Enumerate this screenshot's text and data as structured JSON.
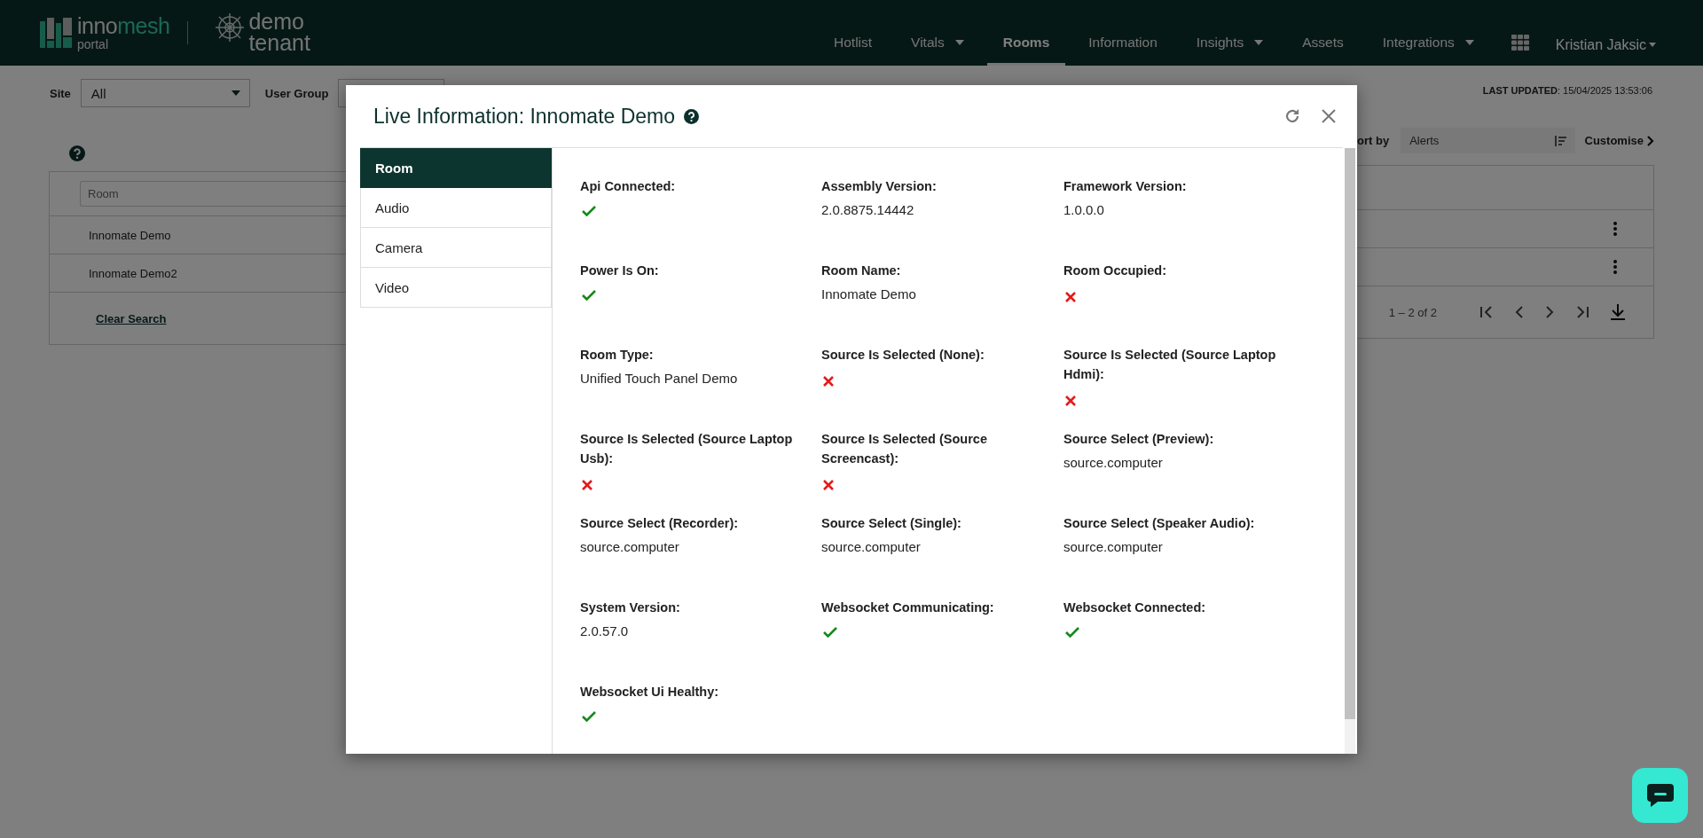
{
  "header": {
    "logo": {
      "brand_a": "inno",
      "brand_b": "mesh",
      "sub": "portal"
    },
    "tenant": {
      "line1": "demo",
      "line2": "tenant"
    },
    "nav": [
      {
        "label": "Hotlist",
        "selected": false,
        "dropdown": false
      },
      {
        "label": "Vitals",
        "selected": false,
        "dropdown": true
      },
      {
        "label": "Rooms",
        "selected": true,
        "dropdown": false
      },
      {
        "label": "Information",
        "selected": false,
        "dropdown": false
      },
      {
        "label": "Insights",
        "selected": false,
        "dropdown": true
      },
      {
        "label": "Assets",
        "selected": false,
        "dropdown": false
      },
      {
        "label": "Integrations",
        "selected": false,
        "dropdown": true
      }
    ],
    "user": "Kristian Jaksic"
  },
  "filters": {
    "site_label": "Site",
    "site_value": "All",
    "user_group_label": "User Group"
  },
  "last_updated": {
    "label": "LAST UPDATED",
    "value": ": 15/04/2025 13:53:06"
  },
  "sort": {
    "label": "ort by",
    "value": "Alerts",
    "customise": "Customise"
  },
  "table": {
    "search_placeholder": "Room",
    "rows": [
      {
        "name": "Innomate Demo"
      },
      {
        "name": "Innomate Demo2"
      }
    ],
    "clear": "Clear Search",
    "range": "1 – 2 of 2"
  },
  "modal": {
    "title": "Live Information: Innomate Demo",
    "tabs": [
      {
        "label": "Room",
        "selected": true
      },
      {
        "label": "Audio",
        "selected": false
      },
      {
        "label": "Camera",
        "selected": false
      },
      {
        "label": "Video",
        "selected": false
      }
    ],
    "fields": [
      {
        "label": "Api Connected:",
        "kind": "status",
        "ok": true
      },
      {
        "label": "Assembly Version:",
        "kind": "text",
        "value": "2.0.8875.14442"
      },
      {
        "label": "Framework Version:",
        "kind": "text",
        "value": "1.0.0.0"
      },
      {
        "label": "Power Is On:",
        "kind": "status",
        "ok": true
      },
      {
        "label": "Room Name:",
        "kind": "text",
        "value": "Innomate Demo"
      },
      {
        "label": "Room Occupied:",
        "kind": "status",
        "ok": false
      },
      {
        "label": "Room Type:",
        "kind": "text",
        "value": "Unified Touch Panel Demo"
      },
      {
        "label": "Source Is Selected (None):",
        "kind": "status",
        "ok": false
      },
      {
        "label": "Source Is Selected (Source Laptop Hdmi):",
        "kind": "status",
        "ok": false
      },
      {
        "label": "Source Is Selected (Source Laptop Usb):",
        "kind": "status",
        "ok": false
      },
      {
        "label": "Source Is Selected (Source Screencast):",
        "kind": "status",
        "ok": false
      },
      {
        "label": "Source Select (Preview):",
        "kind": "text",
        "value": "source.computer"
      },
      {
        "label": "Source Select (Recorder):",
        "kind": "text",
        "value": "source.computer"
      },
      {
        "label": "Source Select (Single):",
        "kind": "text",
        "value": "source.computer"
      },
      {
        "label": "Source Select (Speaker Audio):",
        "kind": "text",
        "value": "source.computer"
      },
      {
        "label": "System Version:",
        "kind": "text",
        "value": "2.0.57.0"
      },
      {
        "label": "Websocket Communicating:",
        "kind": "status",
        "ok": true
      },
      {
        "label": "Websocket Connected:",
        "kind": "status",
        "ok": true
      },
      {
        "label": "Websocket Ui Healthy:",
        "kind": "status",
        "ok": true
      }
    ]
  }
}
